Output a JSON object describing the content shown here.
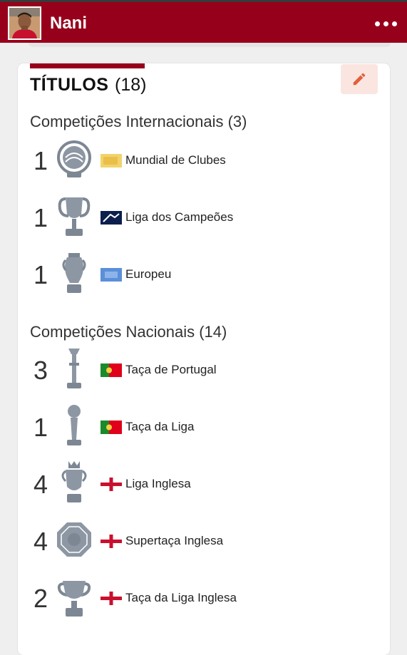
{
  "header": {
    "player_name": "Nani",
    "colors": {
      "bar": "#97001b",
      "text": "#ffffff"
    }
  },
  "titles_card": {
    "heading": "TÍTULOS",
    "total": "(18)",
    "edit_icon": "pencil-icon",
    "sections": [
      {
        "title": "Competições Internacionais (3)",
        "items": [
          {
            "count": "1",
            "trophy_icon": "club-world-cup-trophy-icon",
            "flag_icon": "fifa-flag-icon",
            "label": "Mundial de Clubes"
          },
          {
            "count": "1",
            "trophy_icon": "champions-league-trophy-icon",
            "flag_icon": "uefa-champions-flag-icon",
            "label": "Liga dos Campeões"
          },
          {
            "count": "1",
            "trophy_icon": "euro-trophy-icon",
            "flag_icon": "uefa-flag-icon",
            "label": "Europeu"
          }
        ]
      },
      {
        "title": "Competições Nacionais (14)",
        "items": [
          {
            "count": "3",
            "trophy_icon": "portugal-cup-trophy-icon",
            "flag_icon": "portugal-flag-icon",
            "label": "Taça de Portugal"
          },
          {
            "count": "1",
            "trophy_icon": "league-cup-trophy-icon",
            "flag_icon": "portugal-flag-icon",
            "label": "Taça da Liga"
          },
          {
            "count": "4",
            "trophy_icon": "premier-league-trophy-icon",
            "flag_icon": "england-flag-icon",
            "label": "Liga Inglesa"
          },
          {
            "count": "4",
            "trophy_icon": "community-shield-trophy-icon",
            "flag_icon": "england-flag-icon",
            "label": "Supertaça Inglesa"
          },
          {
            "count": "2",
            "trophy_icon": "efl-cup-trophy-icon",
            "flag_icon": "england-flag-icon",
            "label": "Taça da Liga Inglesa"
          }
        ]
      }
    ]
  }
}
